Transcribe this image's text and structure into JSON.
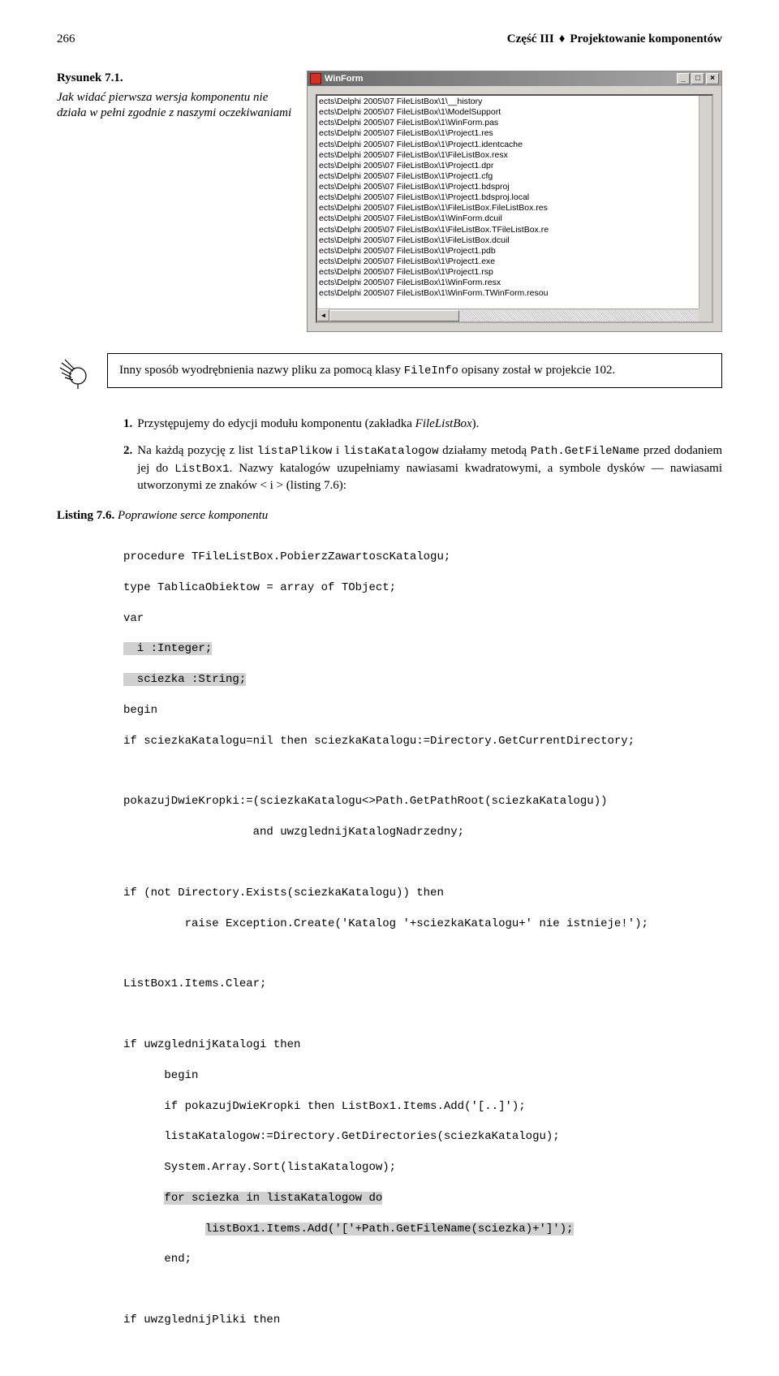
{
  "header": {
    "page_num": "266",
    "section": "Część III",
    "diamond": "♦",
    "title": "Projektowanie komponentów"
  },
  "figure": {
    "label": "Rysunek 7.1.",
    "caption": "Jak widać pierwsza wersja komponentu nie działa w pełni zgodnie z naszymi oczekiwaniami"
  },
  "winform": {
    "title": "WinForm",
    "btn_min": "_",
    "btn_max": "□",
    "btn_close": "×",
    "lines": [
      "ects\\Delphi 2005\\07 FileListBox\\1\\__history",
      "ects\\Delphi 2005\\07 FileListBox\\1\\ModelSupport",
      "ects\\Delphi 2005\\07 FileListBox\\1\\WinForm.pas",
      "ects\\Delphi 2005\\07 FileListBox\\1\\Project1.res",
      "ects\\Delphi 2005\\07 FileListBox\\1\\Project1.identcache",
      "ects\\Delphi 2005\\07 FileListBox\\1\\FileListBox.resx",
      "ects\\Delphi 2005\\07 FileListBox\\1\\Project1.dpr",
      "ects\\Delphi 2005\\07 FileListBox\\1\\Project1.cfg",
      "ects\\Delphi 2005\\07 FileListBox\\1\\Project1.bdsproj",
      "ects\\Delphi 2005\\07 FileListBox\\1\\Project1.bdsproj.local",
      "ects\\Delphi 2005\\07 FileListBox\\1\\FileListBox.FileListBox.res",
      "ects\\Delphi 2005\\07 FileListBox\\1\\WinForm.dcuil",
      "ects\\Delphi 2005\\07 FileListBox\\1\\FileListBox.TFileListBox.re",
      "ects\\Delphi 2005\\07 FileListBox\\1\\FileListBox.dcuil",
      "ects\\Delphi 2005\\07 FileListBox\\1\\Project1.pdb",
      "ects\\Delphi 2005\\07 FileListBox\\1\\Project1.exe",
      "ects\\Delphi 2005\\07 FileListBox\\1\\Project1.rsp",
      "ects\\Delphi 2005\\07 FileListBox\\1\\WinForm.resx",
      "ects\\Delphi 2005\\07 FileListBox\\1\\WinForm.TWinForm.resou"
    ],
    "sb_left": "◄",
    "sb_right": "►"
  },
  "tip": {
    "text_pre": "Inny sposób wyodrębnienia nazwy pliku za pomocą klasy ",
    "code": "FileInfo",
    "text_post": " opisany został w projekcie 102."
  },
  "ol": [
    {
      "num": "1.",
      "parts": [
        {
          "t": "Przystępujemy do edycji modułu komponentu (zakładka "
        },
        {
          "t": "FileListBox",
          "ital": true
        },
        {
          "t": ")."
        }
      ]
    },
    {
      "num": "2.",
      "parts": [
        {
          "t": "Na każdą pozycję z list "
        },
        {
          "t": "listaPlikow",
          "mono": true
        },
        {
          "t": " i "
        },
        {
          "t": "listaKatalogow",
          "mono": true
        },
        {
          "t": " działamy metodą "
        },
        {
          "t": "Path.GetFileName",
          "mono": true
        },
        {
          "t": " przed dodaniem jej do "
        },
        {
          "t": "ListBox1",
          "mono": true
        },
        {
          "t": ". Nazwy katalogów uzupełniamy nawiasami kwadratowymi, a symbole dysków — nawiasami utworzonymi ze znaków < i > (listing 7.6):"
        }
      ]
    }
  ],
  "listing": {
    "label_b": "Listing 7.6.",
    "label_i": " Poprawione serce komponentu"
  },
  "code": {
    "l01": "procedure TFileListBox.PobierzZawartoscKatalogu;",
    "l02": "type TablicaObiektow = array of TObject;",
    "l03": "var",
    "l04": "  i :Integer;",
    "l05": "  sciezka :String;",
    "l06": "begin",
    "l07": "if sciezkaKatalogu=nil then sciezkaKatalogu:=Directory.GetCurrentDirectory;",
    "l08": "",
    "l09": "pokazujDwieKropki:=(sciezkaKatalogu<>Path.GetPathRoot(sciezkaKatalogu))",
    "l10": "                   and uwzglednijKatalogNadrzedny;",
    "l11": "",
    "l12": "if (not Directory.Exists(sciezkaKatalogu)) then",
    "l13": "         raise Exception.Create('Katalog '+sciezkaKatalogu+' nie istnieje!');",
    "l14": "",
    "l15": "ListBox1.Items.Clear;",
    "l16": "",
    "l17": "if uwzglednijKatalogi then",
    "l18": "      begin",
    "l19": "      if pokazujDwieKropki then ListBox1.Items.Add('[..]');",
    "l20": "      listaKatalogow:=Directory.GetDirectories(sciezkaKatalogu);",
    "l21": "      System.Array.Sort(listaKatalogow);",
    "l22a": "      ",
    "l22b": "for sciezka in listaKatalogow do",
    "l23a": "            ",
    "l23b": "listBox1.Items.Add('['+Path.GetFileName(sciezka)+']');",
    "l24": "      end;",
    "l25": "",
    "l26": "if uwzglednijPliki then"
  }
}
